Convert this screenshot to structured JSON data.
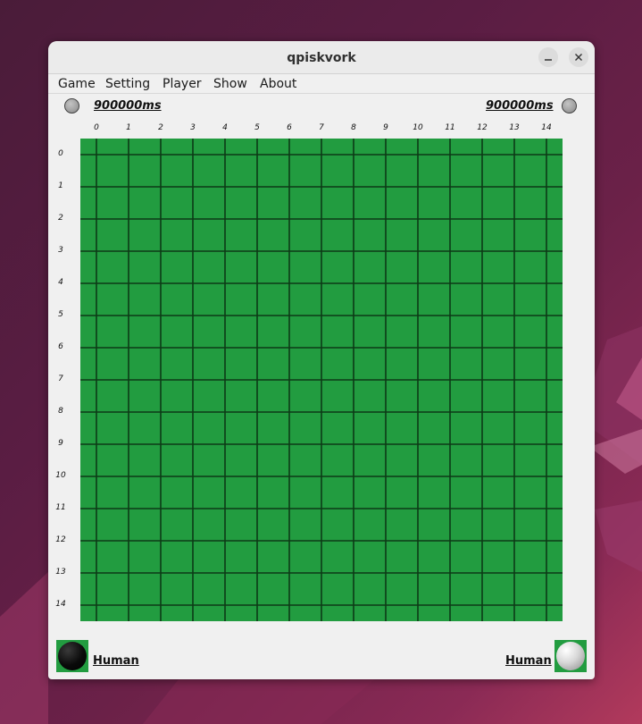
{
  "window": {
    "title": "qpiskvork"
  },
  "menu": {
    "items": [
      "Game",
      "Setting",
      "Player",
      "Show",
      "About"
    ]
  },
  "timers": {
    "left": "900000ms",
    "right": "900000ms"
  },
  "board": {
    "size": 15,
    "column_labels": [
      "0",
      "1",
      "2",
      "3",
      "4",
      "5",
      "6",
      "7",
      "8",
      "9",
      "10",
      "11",
      "12",
      "13",
      "14"
    ],
    "row_labels": [
      "0",
      "1",
      "2",
      "3",
      "4",
      "5",
      "6",
      "7",
      "8",
      "9",
      "10",
      "11",
      "12",
      "13",
      "14"
    ],
    "background_color": "#229c40",
    "line_color": "#0d3a17",
    "stones": []
  },
  "players": {
    "left": {
      "name": "Human",
      "stone": "black"
    },
    "right": {
      "name": "Human",
      "stone": "white"
    }
  },
  "icons": {
    "minimize": "minimize-icon",
    "close": "close-icon"
  }
}
